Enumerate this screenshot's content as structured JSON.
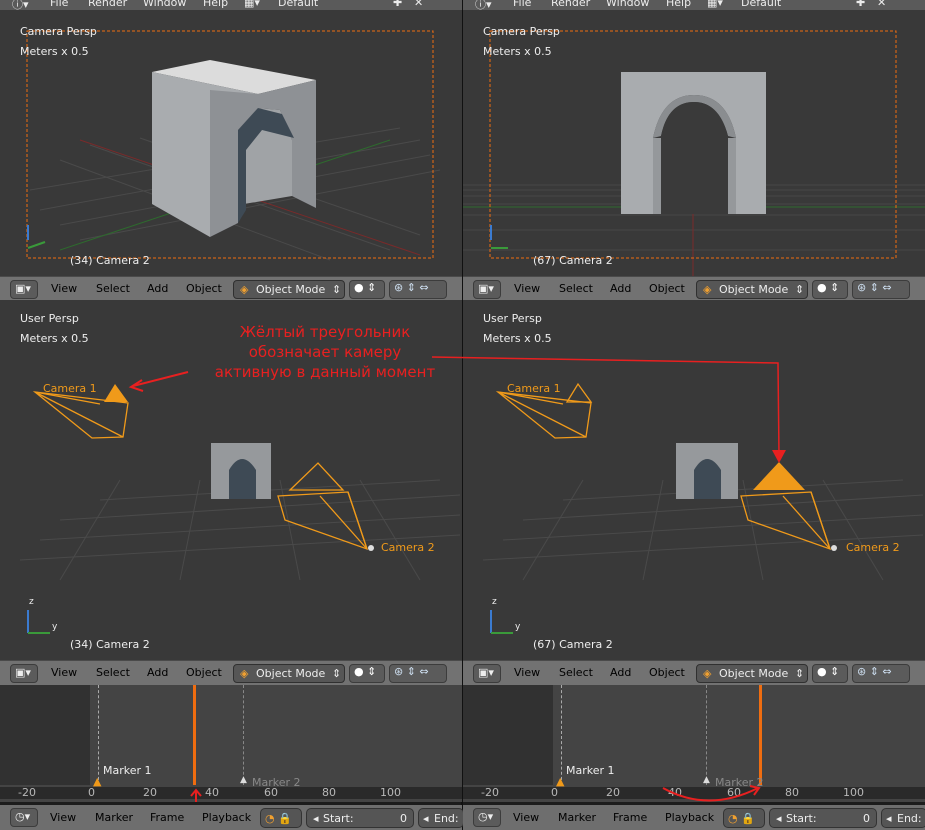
{
  "topbar": {
    "file": "File",
    "render": "Render",
    "window": "Window",
    "help": "Help",
    "layout": "Default"
  },
  "top_left": {
    "view_label": "Camera Persp",
    "scale": "Meters x 0.5",
    "footer": "(34) Camera 2"
  },
  "top_right": {
    "view_label": "Camera Persp",
    "scale": "Meters x 0.5",
    "footer": "(67) Camera 2"
  },
  "bottom_left": {
    "view_label": "User Persp",
    "scale": "Meters x 0.5",
    "footer": "(34) Camera 2",
    "camera1": "Camera 1",
    "camera2": "Camera 2"
  },
  "bottom_right": {
    "view_label": "User Persp",
    "scale": "Meters x 0.5",
    "footer": "(67) Camera 2",
    "camera1": "Camera 1",
    "camera2": "Camera 2"
  },
  "viewport_header": {
    "view": "View",
    "select": "Select",
    "add": "Add",
    "object": "Object",
    "mode": "Object Mode"
  },
  "annotation": {
    "line1": "Жёлтый треугольник",
    "line2": "обозначает камеру",
    "line3": "активную в данный момент"
  },
  "axes": {
    "z": "z",
    "y": "y"
  },
  "timeline": {
    "ticks": [
      "-20",
      "0",
      "20",
      "40",
      "60",
      "80",
      "100"
    ],
    "marker1": "Marker 1",
    "marker2": "Marker 2",
    "left_current_frame": 34,
    "right_current_frame": 67
  },
  "timeline_bar": {
    "view": "View",
    "marker": "Marker",
    "frame": "Frame",
    "playback": "Playback",
    "start_label": "Start:",
    "start_value": "0",
    "end_label": "End:"
  },
  "colors": {
    "accent": "#f06d10",
    "camera": "#f09a1a",
    "annotation": "#e82020"
  }
}
